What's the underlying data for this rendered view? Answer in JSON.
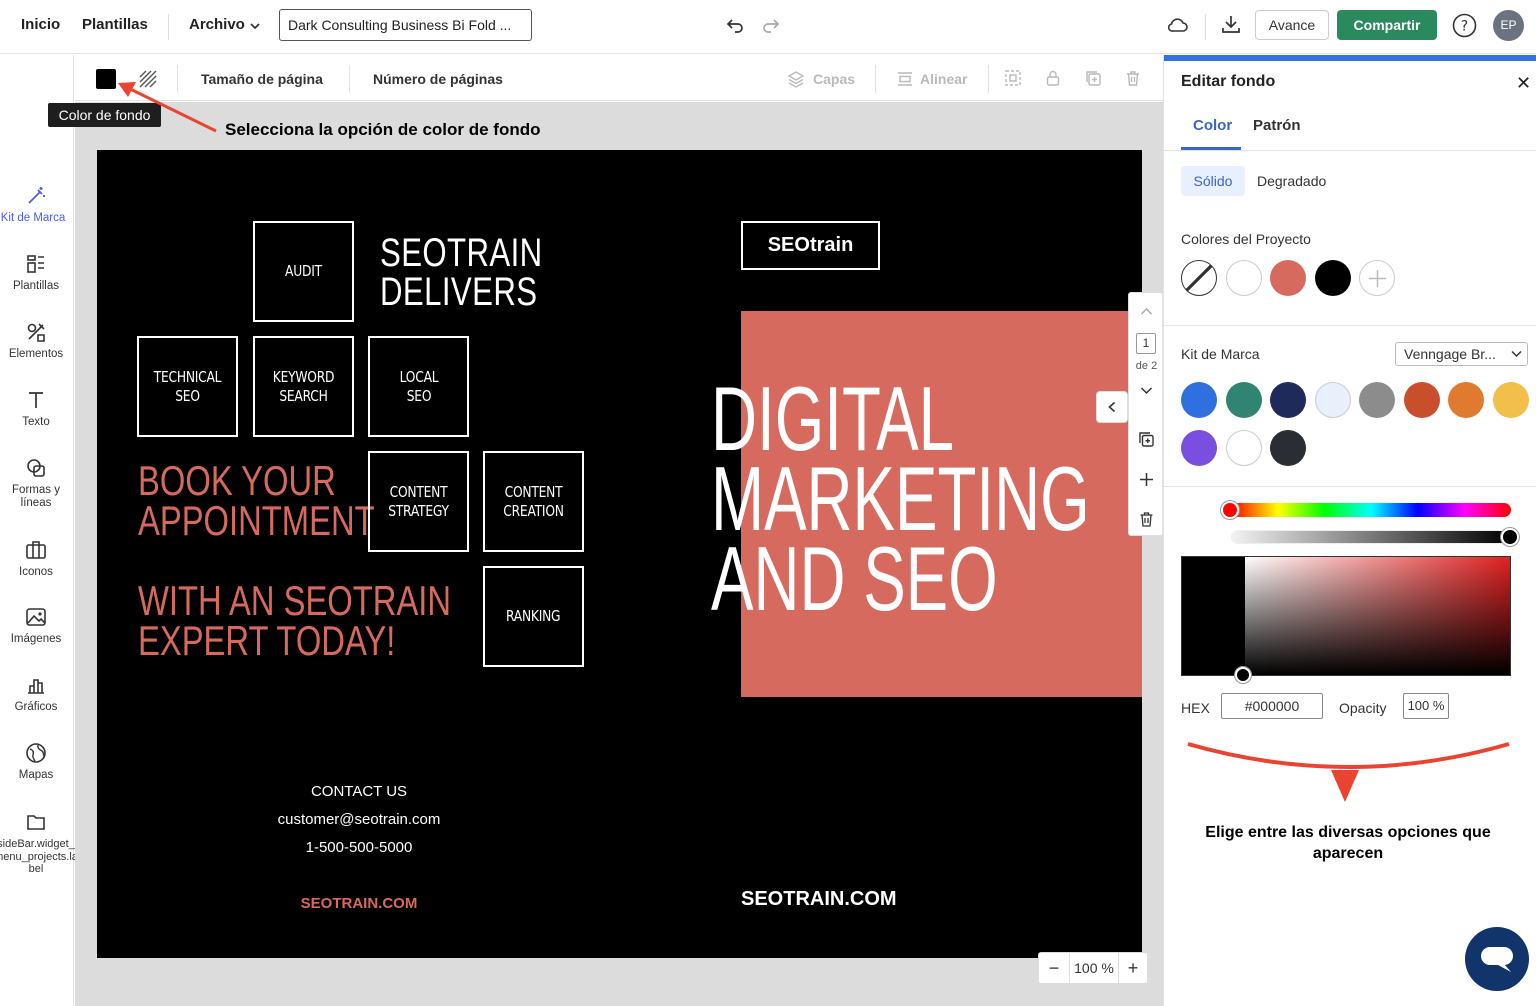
{
  "topbar": {
    "home": "Inicio",
    "templates": "Plantillas",
    "file_menu": "Archivo",
    "doc_title": "Dark Consulting Business Bi Fold ...",
    "preview": "Avance",
    "share": "Compartir",
    "avatar": "EP",
    "colors": {
      "share_bg": "#2a8a5e"
    }
  },
  "sidebar": {
    "items": [
      {
        "label": "Kit de Marca",
        "icon": "magic-wand-icon"
      },
      {
        "label": "Plantillas",
        "icon": "templates-icon"
      },
      {
        "label": "Elementos",
        "icon": "elements-icon"
      },
      {
        "label": "Texto",
        "icon": "text-icon"
      },
      {
        "label": "Formas y líneas",
        "icon": "shapes-icon"
      },
      {
        "label": "Iconos",
        "icon": "icons-icon"
      },
      {
        "label": "Imágenes",
        "icon": "images-icon"
      },
      {
        "label": "Gráficos",
        "icon": "charts-icon"
      },
      {
        "label": "Mapas",
        "icon": "maps-icon"
      },
      {
        "label": "sideBar.widget_menu_projects.label",
        "icon": "folder-icon"
      }
    ]
  },
  "toolbar": {
    "page_size": "Tamaño de página",
    "page_count": "Número de páginas",
    "layers": "Capas",
    "align": "Alinear"
  },
  "tooltip": "Color de fondo",
  "annotations": {
    "top": "Selecciona la opción de color de fondo",
    "panel": "Elige entre las diversas opciones que aparecen"
  },
  "design": {
    "boxes": {
      "audit": "AUDIT",
      "technical": "TECHNICAL SEO",
      "keyword": "KEYWORD SEARCH",
      "local": "LOCAL SEO",
      "content_strategy": "CONTENT STRATEGY",
      "content_creation": "CONTENT CREATION",
      "ranking": "RANKING"
    },
    "heading_line1": "SEOTRAIN",
    "heading_line2": "DELIVERS",
    "book_line1": "BOOK YOUR",
    "book_line2": "APPOINTMENT",
    "expert_line1": "WITH AN SEOTRAIN",
    "expert_line2": "EXPERT TODAY!",
    "contact_title": "CONTACT US",
    "email": "customer@seotrain.com",
    "phone": "1-500-500-5000",
    "site_left": "SEOTRAIN.COM",
    "logo": "SEOtrain",
    "big_line1": "DIGITAL",
    "big_line2": "MARKETING",
    "big_line3": "AND SEO",
    "site_right": "SEOTRAIN.COM",
    "colors": {
      "background": "#000000",
      "accent": "#d76a5f"
    }
  },
  "page_nav": {
    "current": "1",
    "of": "de 2"
  },
  "zoom": {
    "value": "100 %"
  },
  "panel": {
    "title": "Editar fondo",
    "tab_color": "Color",
    "tab_pattern": "Patrón",
    "solid": "Sólido",
    "gradient": "Degradado",
    "project_colors_label": "Colores del Proyecto",
    "project_colors": [
      "transparent",
      "#ffffff",
      "#d76a5f",
      "#000000"
    ],
    "brand_kit_label": "Kit de Marca",
    "brand_select": "Venngage Br...",
    "brand_colors": [
      "#2f6fe0",
      "#2f8572",
      "#1e2a5a",
      "#e8f0fc",
      "#8c8c8c",
      "#c94f2c",
      "#e07a2e",
      "#f2c04a",
      "#7a4fe0",
      "#ffffff",
      "#2a2d33"
    ],
    "hex_label": "HEX",
    "hex_value": "#000000",
    "opacity_label": "Opacity",
    "opacity_value": "100 %"
  }
}
